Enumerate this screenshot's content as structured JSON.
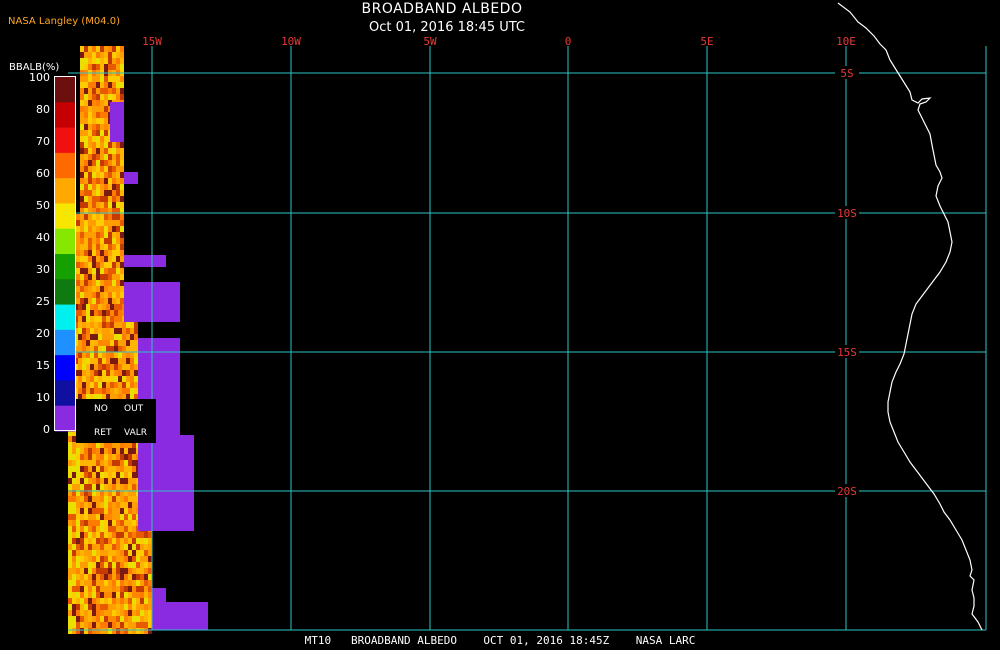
{
  "title": "BROADBAND ALBEDO",
  "subtitle": "Oct 01, 2016 18:45 UTC",
  "credit": "NASA Langley (M04.0)",
  "footer": "MT10   BROADBAND ALBEDO    OCT 01, 2016 18:45Z    NASA LARC",
  "colorbar": {
    "title": "BBALB(%)",
    "labels": [
      "100",
      "80",
      "70",
      "60",
      "50",
      "40",
      "30",
      "25",
      "20",
      "15",
      "10",
      "0"
    ],
    "colors": [
      "#6b0f0f",
      "#c40000",
      "#f01010",
      "#ff6a00",
      "#ffa800",
      "#f7e600",
      "#86e800",
      "#16a000",
      "#0f7a0f",
      "#00f0f0",
      "#1e90ff",
      "#0000ff",
      "#1010a0",
      "#8a2be2"
    ],
    "no_retrieval": {
      "line1a": "NO",
      "line1b": "OUT",
      "line2a": "RET",
      "line2b": "VALR"
    }
  },
  "grid": {
    "longitudes": [
      {
        "label": "15W"
      },
      {
        "label": "10W"
      },
      {
        "label": "5W"
      },
      {
        "label": "0"
      },
      {
        "label": "5E"
      },
      {
        "label": "10E"
      }
    ],
    "latitudes": [
      {
        "label": "5S"
      },
      {
        "label": "10S"
      },
      {
        "label": "15S"
      },
      {
        "label": "20S"
      }
    ]
  }
}
